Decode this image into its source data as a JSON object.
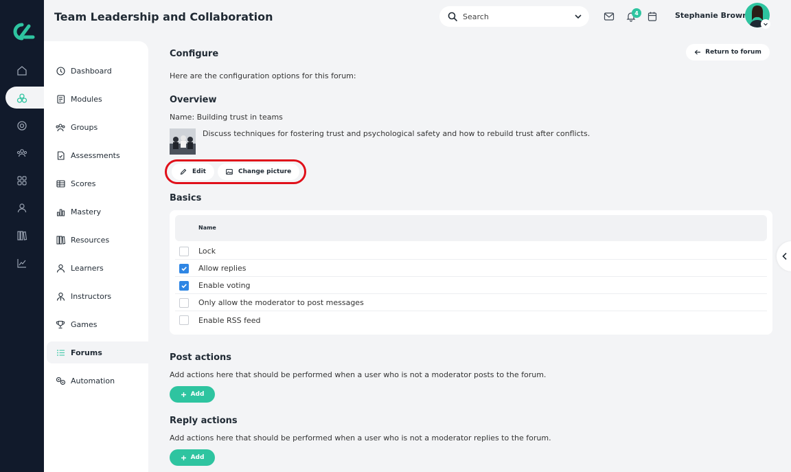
{
  "app": {
    "title": "Team Leadership and Collaboration"
  },
  "rail": {
    "items": [
      {
        "icon": "home-icon"
      },
      {
        "icon": "cubes-icon",
        "active": true
      },
      {
        "icon": "target-icon"
      },
      {
        "icon": "people-icon"
      },
      {
        "icon": "grid-icon"
      },
      {
        "icon": "person-icon"
      },
      {
        "icon": "books-icon"
      },
      {
        "icon": "chart-line-icon"
      }
    ]
  },
  "header": {
    "search_label": "Search",
    "notification_count": "4",
    "user_name": "Stephanie Brown"
  },
  "sidebar": {
    "items": [
      {
        "label": "Dashboard",
        "icon": "dashboard-icon"
      },
      {
        "label": "Modules",
        "icon": "book-icon"
      },
      {
        "label": "Groups",
        "icon": "groups-icon"
      },
      {
        "label": "Assessments",
        "icon": "assessment-icon"
      },
      {
        "label": "Scores",
        "icon": "table-icon"
      },
      {
        "label": "Mastery",
        "icon": "bar-chart-icon"
      },
      {
        "label": "Resources",
        "icon": "library-icon"
      },
      {
        "label": "Learners",
        "icon": "learner-icon"
      },
      {
        "label": "Instructors",
        "icon": "instructor-icon"
      },
      {
        "label": "Games",
        "icon": "trophy-icon"
      },
      {
        "label": "Forums",
        "icon": "list-icon",
        "active": true
      },
      {
        "label": "Automation",
        "icon": "automation-icon"
      }
    ]
  },
  "main": {
    "heading": "Configure",
    "return_label": "Return to forum",
    "intro": "Here are the configuration options for this forum:",
    "overview": {
      "heading": "Overview",
      "name_line": "Name: Building trust in teams",
      "description": "Discuss techniques for fostering trust and psychological safety and how to rebuild trust after conflicts.",
      "edit_label": "Edit",
      "change_picture_label": "Change picture"
    },
    "basics": {
      "heading": "Basics",
      "column_header": "Name",
      "options": [
        {
          "label": "Lock",
          "checked": false
        },
        {
          "label": "Allow replies",
          "checked": true
        },
        {
          "label": "Enable voting",
          "checked": true
        },
        {
          "label": "Only allow the moderator to post messages",
          "checked": false
        },
        {
          "label": "Enable RSS feed",
          "checked": false
        }
      ]
    },
    "post_actions": {
      "heading": "Post actions",
      "description": "Add actions here that should be performed when a user who is not a moderator posts to the forum.",
      "add_label": "Add"
    },
    "reply_actions": {
      "heading": "Reply actions",
      "description": "Add actions here that should be performed when a user who is not a moderator replies to the forum.",
      "add_label": "Add"
    }
  },
  "colors": {
    "accent": "#2ec4a0",
    "rail": "#111a2b",
    "checkbox": "#2f86e4",
    "highlight": "#e0101a"
  }
}
